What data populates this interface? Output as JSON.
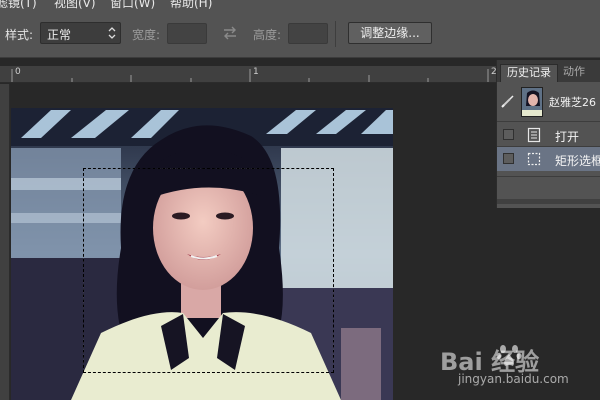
{
  "menu": [
    "滤镜(T)",
    "视图(V)",
    "窗口(W)",
    "帮助(H)"
  ],
  "options": {
    "style_label": "样式:",
    "style_value": "正常",
    "width_label": "宽度:",
    "height_label": "高度:",
    "refine_button": "调整边缘..."
  },
  "ruler": {
    "marks": [
      "0",
      "1",
      "2"
    ]
  },
  "panel": {
    "tabs": [
      "历史记录",
      "动作"
    ],
    "snapshot_title": "赵雅芝26",
    "items": [
      {
        "label": "打开"
      },
      {
        "label": "矩形选框"
      }
    ]
  },
  "watermark": {
    "brand": "Bai  经验",
    "url": "jingyan.baidu.com"
  },
  "colors": {
    "ui_bg": "#535353",
    "canvas_bg": "#282828",
    "selected_row": "#6a7485"
  }
}
